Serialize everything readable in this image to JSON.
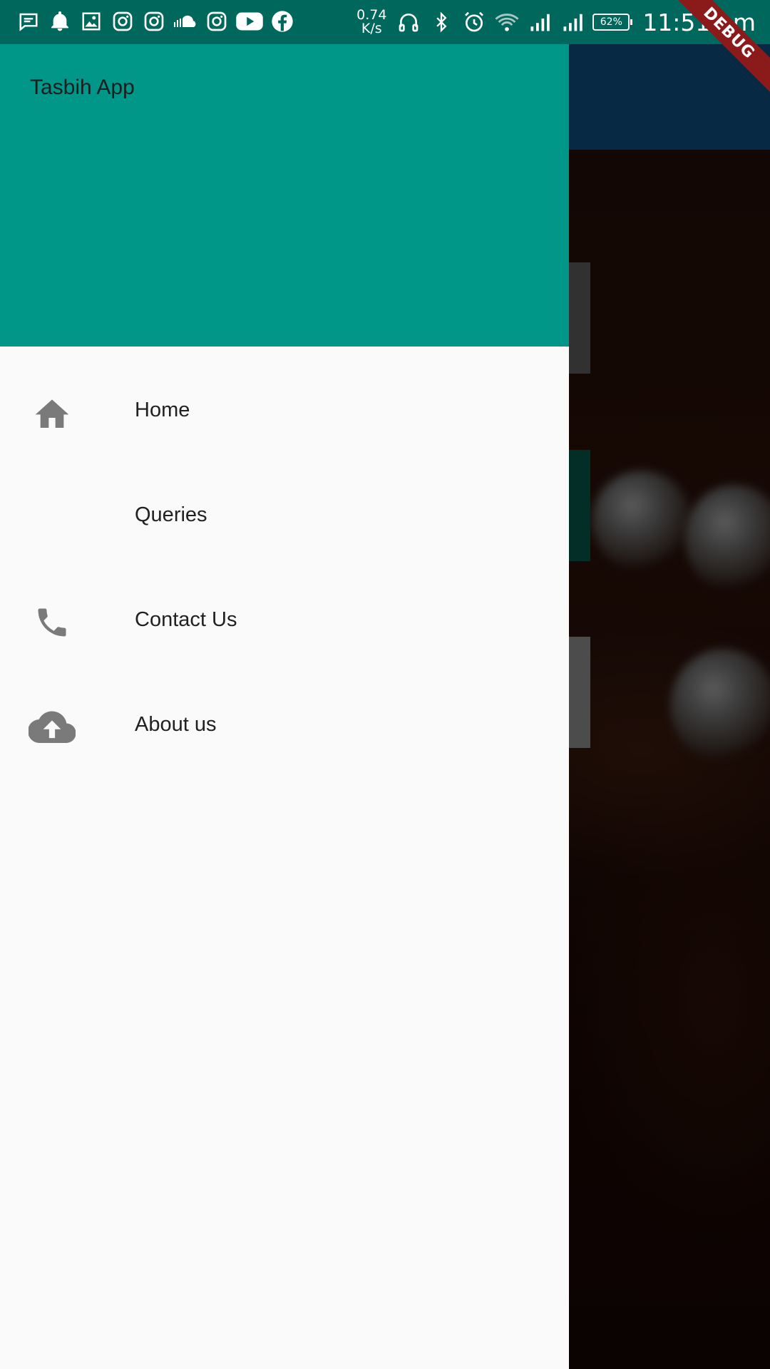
{
  "status_bar": {
    "net_speed_value": "0.74",
    "net_speed_unit": "K/s",
    "battery": "62%",
    "time": "11:51 pm",
    "left_icons": [
      "message-icon",
      "bell-icon",
      "image-icon",
      "instagram-icon",
      "instagram-icon",
      "soundcloud-icon",
      "instagram-icon",
      "youtube-icon",
      "facebook-icon"
    ],
    "right_icons": [
      "headphones-icon",
      "bluetooth-icon",
      "alarm-icon",
      "wifi-icon",
      "signal-icon",
      "signal-icon",
      "battery-icon"
    ]
  },
  "debug_banner": "DEBUG",
  "drawer": {
    "header_title": "Tasbih App",
    "header_color": "#009688",
    "items": [
      {
        "label": "Home",
        "icon": "home-icon"
      },
      {
        "label": "Queries",
        "icon": ""
      },
      {
        "label": "Contact Us",
        "icon": "phone-icon"
      },
      {
        "label": "About us",
        "icon": "cloud-upload-icon"
      }
    ]
  },
  "colors": {
    "status_bar": "#00675d",
    "app_bar_behind": "#0f4c7d",
    "debug": "#8b1a1a",
    "icon_gray": "#7a7a7a"
  }
}
